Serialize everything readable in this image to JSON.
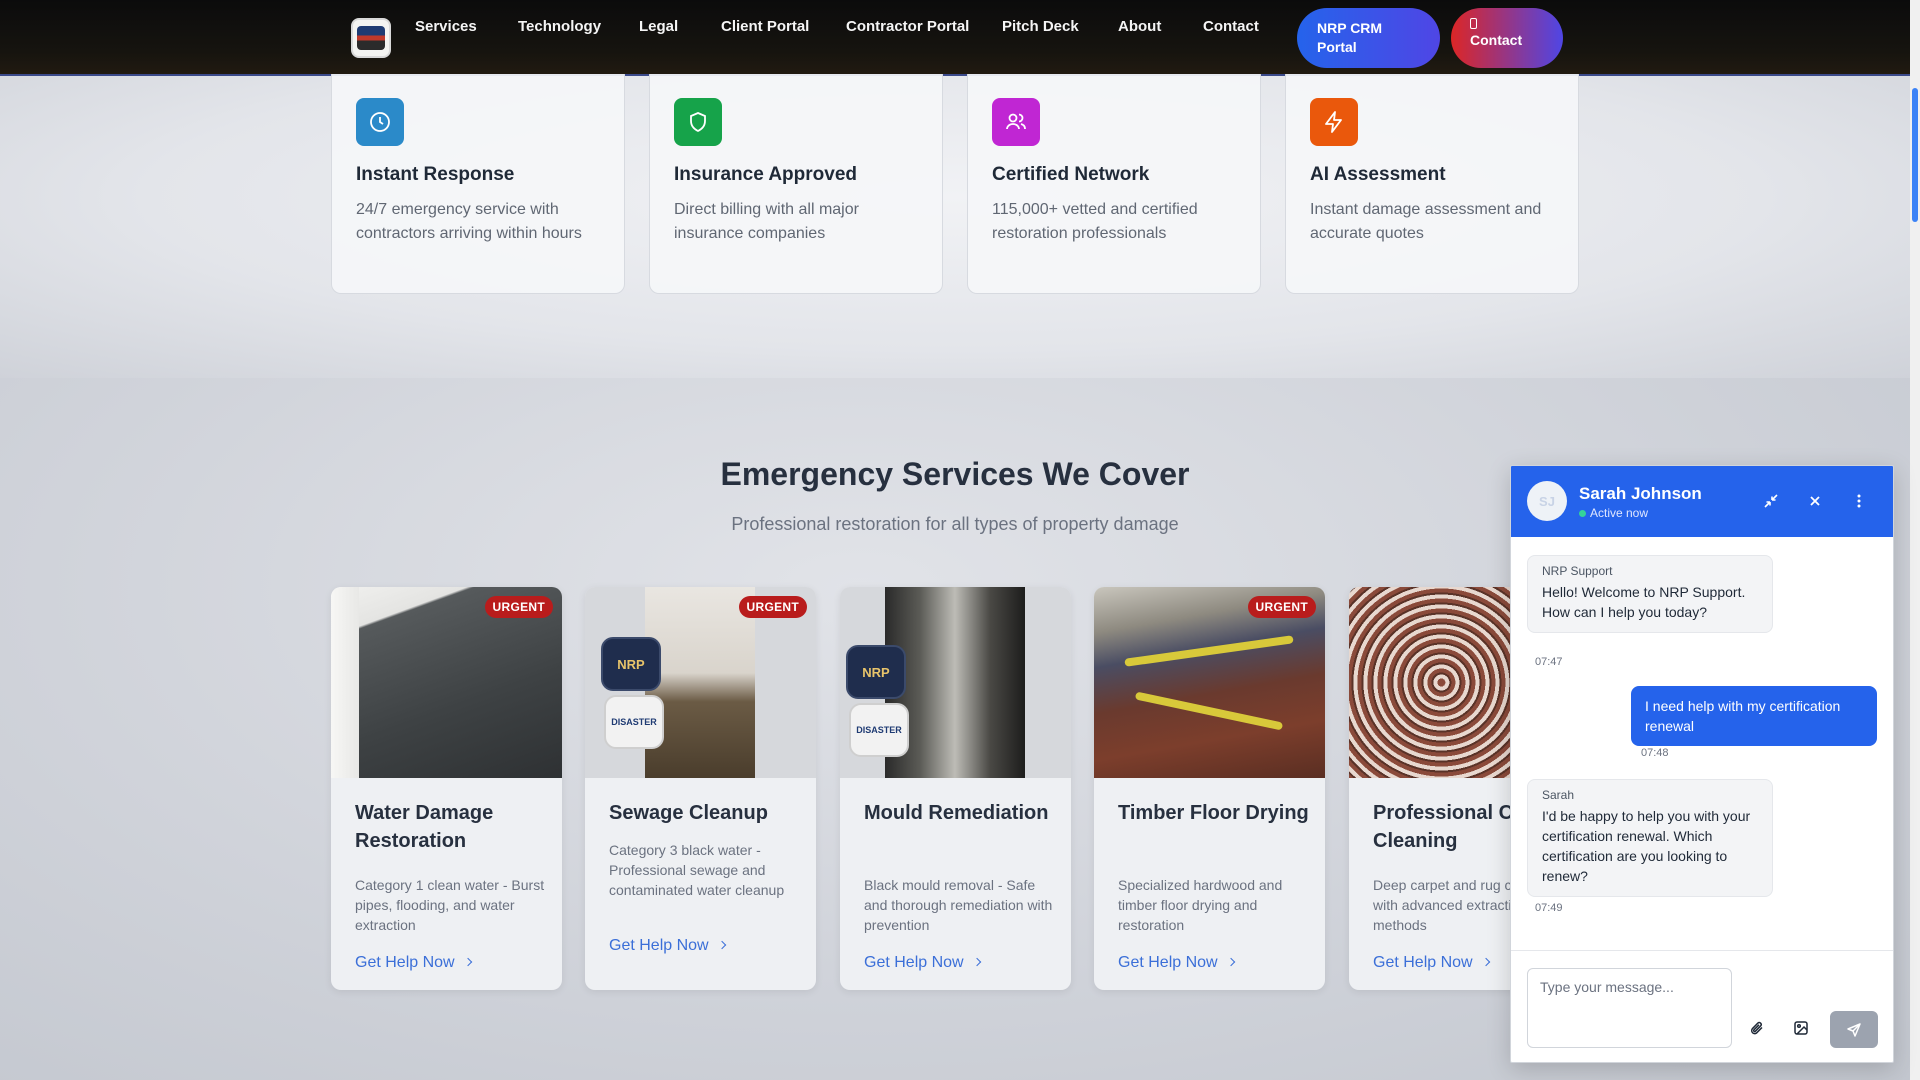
{
  "nav": {
    "links": [
      "Services",
      "Technology",
      "Legal",
      "Client Portal",
      "Contractor Portal",
      "Pitch Deck",
      "About",
      "Contact"
    ],
    "crm_button": "NRP CRM Portal",
    "contact_button": "Contact"
  },
  "features": [
    {
      "title": "Instant Response",
      "desc": "24/7 emergency service with contractors arriving within hours",
      "icon": "clock-icon",
      "color": "#2b8ac9"
    },
    {
      "title": "Insurance Approved",
      "desc": "Direct billing with all major insurance companies",
      "icon": "shield-icon",
      "color": "#16a34a"
    },
    {
      "title": "Certified Network",
      "desc": "115,000+ vetted and certified restoration professionals",
      "icon": "users-icon",
      "color": "#c026d3"
    },
    {
      "title": "AI Assessment",
      "desc": "Instant damage assessment and accurate quotes",
      "icon": "lightning-icon",
      "color": "#ea580c"
    }
  ],
  "services_section": {
    "title": "Emergency Services We Cover",
    "subtitle": "Professional restoration for all types of property damage",
    "cards": [
      {
        "title": "Water Damage Restoration",
        "desc": "Category 1 clean water - Burst pipes, flooding, and water extraction",
        "badge": "URGENT",
        "link": "Get Help Now"
      },
      {
        "title": "Sewage Cleanup",
        "desc": "Category 3 black water - Professional sewage and contaminated water cleanup",
        "badge": "URGENT",
        "link": "Get Help Now"
      },
      {
        "title": "Mould Remediation",
        "desc": "Black mould removal - Safe and thorough remediation with prevention",
        "badge": "",
        "link": "Get Help Now"
      },
      {
        "title": "Timber Floor Drying",
        "desc": "Specialized hardwood and timber floor drying and restoration",
        "badge": "URGENT",
        "link": "Get Help Now"
      },
      {
        "title": "Professional Carpet Cleaning",
        "desc": "Deep carpet and rug cleaning with advanced extraction methods",
        "badge": "",
        "link": "Get Help Now"
      }
    ],
    "overlay_nrp": "NRP",
    "overlay_disaster": "DISASTER"
  },
  "chat": {
    "agent_name": "Sarah Johnson",
    "avatar_initials": "SJ",
    "status": "Active now",
    "messages": [
      {
        "sender": "NRP Support",
        "text": "Hello! Welcome to NRP Support. How can I help you today?",
        "time": "07:47"
      },
      {
        "text": "I need help with my certification renewal",
        "time": "07:48"
      },
      {
        "sender": "Sarah",
        "text": "I'd be happy to help you with your certification renewal. Which certification are you looking to renew?",
        "time": "07:49"
      }
    ],
    "input_placeholder": "Type your message..."
  }
}
